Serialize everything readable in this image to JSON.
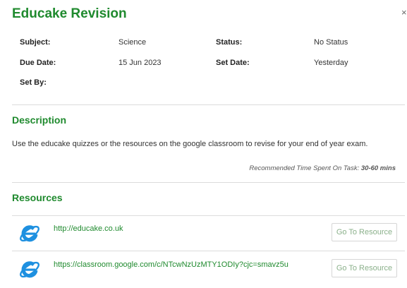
{
  "header": {
    "title": "Educake Revision",
    "close_label": "×"
  },
  "meta": {
    "subject_label": "Subject:",
    "subject_value": "Science",
    "status_label": "Status:",
    "status_value": "No Status",
    "due_label": "Due Date:",
    "due_value": "15 Jun 2023",
    "set_date_label": "Set Date:",
    "set_date_value": "Yesterday",
    "set_by_label": "Set By:",
    "set_by_value": ""
  },
  "description": {
    "heading": "Description",
    "text": "Use the educake quizzes or the resources on the google classroom to revise for your end of year exam.",
    "recommended_label": "Recommended Time Spent On Task:",
    "recommended_value": "30-60 mins"
  },
  "resources": {
    "heading": "Resources",
    "items": [
      {
        "icon": "internet-explorer-icon",
        "url": "http://educake.co.uk",
        "button": "Go To Resource"
      },
      {
        "icon": "internet-explorer-icon",
        "url": "https://classroom.google.com/c/NTcwNzUzMTY1ODIy?cjc=smavz5u",
        "button": "Go To Resource"
      }
    ]
  },
  "colors": {
    "accent": "#1f8a2e",
    "ie_blue": "#1e90e0"
  }
}
